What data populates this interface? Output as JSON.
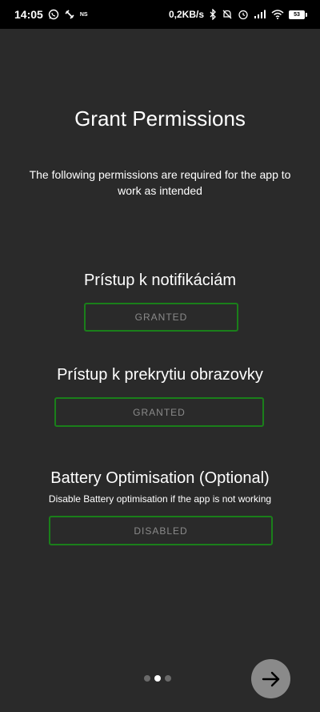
{
  "status_bar": {
    "time": "14:05",
    "ns_label": "NS",
    "network_speed": "0,2KB/s",
    "battery_level": "53"
  },
  "screen": {
    "title": "Grant Permissions",
    "subtitle": "The following permissions are required for the app to work as intended"
  },
  "permissions": [
    {
      "heading": "Prístup k notifikáciám",
      "status": "GRANTED"
    },
    {
      "heading": "Prístup k prekrytiu obrazovky",
      "status": "GRANTED"
    },
    {
      "heading": "Battery Optimisation (Optional)",
      "description": "Disable Battery optimisation if the app is not working",
      "status": "DISABLED"
    }
  ],
  "pager": {
    "current_page": 2,
    "total_pages": 3
  },
  "colors": {
    "background": "#2a2a2a",
    "button_border": "#1a7f1a",
    "button_text": "#8a8a8a",
    "next_button_bg": "#8a8a8a"
  }
}
